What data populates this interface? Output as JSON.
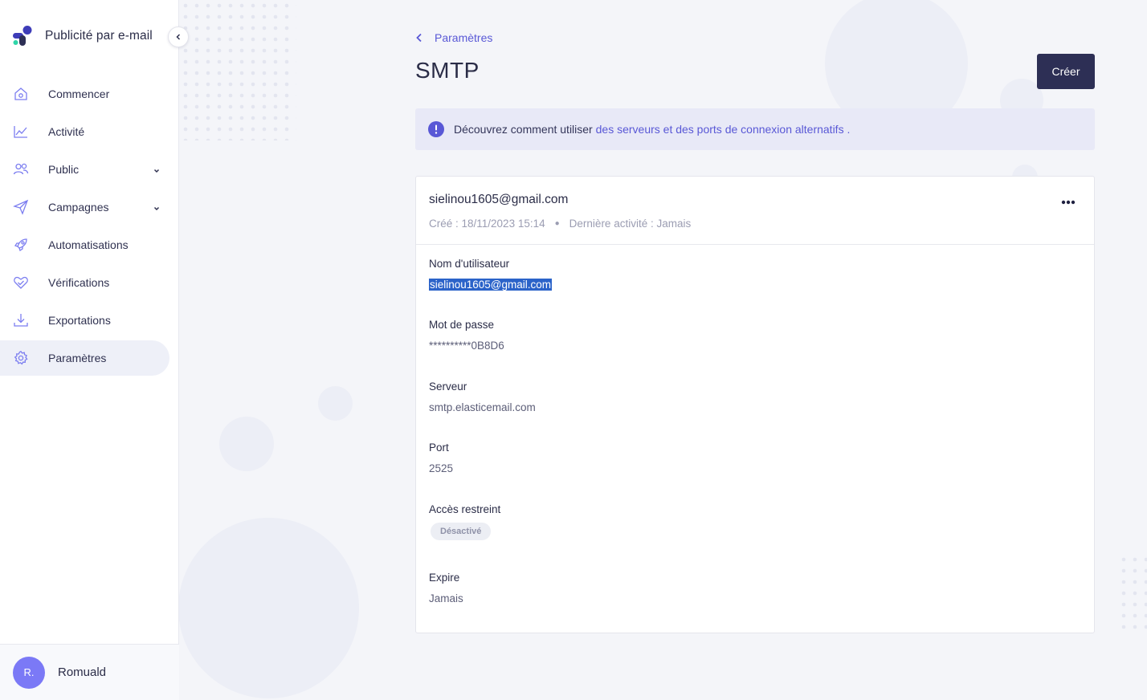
{
  "sidebar": {
    "brand_title": "Publicité par e-mail",
    "items": [
      {
        "label": "Commencer",
        "icon": "home-icon"
      },
      {
        "label": "Activité",
        "icon": "chart-line-icon"
      },
      {
        "label": "Public",
        "icon": "users-icon"
      },
      {
        "label": "Campagnes",
        "icon": "paper-plane-icon"
      },
      {
        "label": "Automatisations",
        "icon": "rocket-icon"
      },
      {
        "label": "Vérifications",
        "icon": "heart-check-icon"
      },
      {
        "label": "Exportations",
        "icon": "download-icon"
      },
      {
        "label": "Paramètres",
        "icon": "gear-icon",
        "active": true
      }
    ],
    "user": {
      "initials": "R.",
      "name": "Romuald"
    }
  },
  "main": {
    "breadcrumb": "Paramètres",
    "title": "SMTP",
    "create_label": "Créer",
    "banner": {
      "text": "Découvrez comment utiliser",
      "link": "des serveurs et des ports de connexion alternatifs",
      "suffix": "."
    },
    "card": {
      "email": "sielinou1605@gmail.com",
      "created": "Créé : 18/11/2023 15:14",
      "last_activity": "Dernière activité : Jamais",
      "fields": {
        "username_label": "Nom d'utilisateur",
        "username_value": "sielinou1605@gmail.com",
        "password_label": "Mot de passe",
        "password_value": "**********0B8D6",
        "server_label": "Serveur",
        "server_value": "smtp.elasticemail.com",
        "port_label": "Port",
        "port_value": "2525",
        "restricted_label": "Accès restreint",
        "restricted_value": "Désactivé",
        "expires_label": "Expire",
        "expires_value": "Jamais"
      }
    }
  },
  "colors": {
    "accent": "#5958d6",
    "primary_button": "#2d2f55",
    "selection": "#2b63c9",
    "avatar": "#7b79f6"
  }
}
